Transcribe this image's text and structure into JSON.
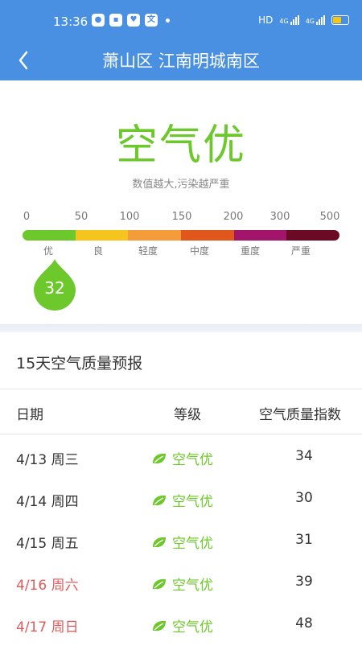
{
  "status_bar": {
    "time": "13:36",
    "notifications": [
      "app-icon-1",
      "app-icon-2",
      "app-icon-3",
      "app-icon-4"
    ],
    "network_label": "HD",
    "signal_1": "4G",
    "signal_2": "4G",
    "battery_level": 0.5,
    "battery_color": "#f5c518"
  },
  "header": {
    "back_icon": "chevron-left-icon",
    "title": "萧山区 江南明城南区",
    "bg_color": "#4a90e2"
  },
  "aqi": {
    "quality_label": "空气优",
    "hint": "数值越大,污染越严重",
    "value": "32",
    "accent_color": "#6cc82b",
    "scale_ticks": [
      "0",
      "50",
      "100",
      "150",
      "200",
      "300",
      "500"
    ],
    "scale_levels": [
      "优",
      "良",
      "轻度",
      "中度",
      "重度",
      "严重"
    ],
    "scale_colors": [
      "#6cc82b",
      "#f5c51d",
      "#f59c3a",
      "#e0561b",
      "#a3156b",
      "#6b0a25"
    ]
  },
  "forecast": {
    "title": "15天空气质量预报",
    "columns": [
      "日期",
      "等级",
      "空气质量指数"
    ],
    "leaf_icon": "leaf-icon",
    "rows": [
      {
        "date": "4/13 周三",
        "level": "空气优",
        "aqi": "34",
        "weekend": false
      },
      {
        "date": "4/14 周四",
        "level": "空气优",
        "aqi": "30",
        "weekend": false
      },
      {
        "date": "4/15 周五",
        "level": "空气优",
        "aqi": "31",
        "weekend": false
      },
      {
        "date": "4/16 周六",
        "level": "空气优",
        "aqi": "39",
        "weekend": true
      },
      {
        "date": "4/17 周日",
        "level": "空气优",
        "aqi": "48",
        "weekend": true
      }
    ]
  }
}
